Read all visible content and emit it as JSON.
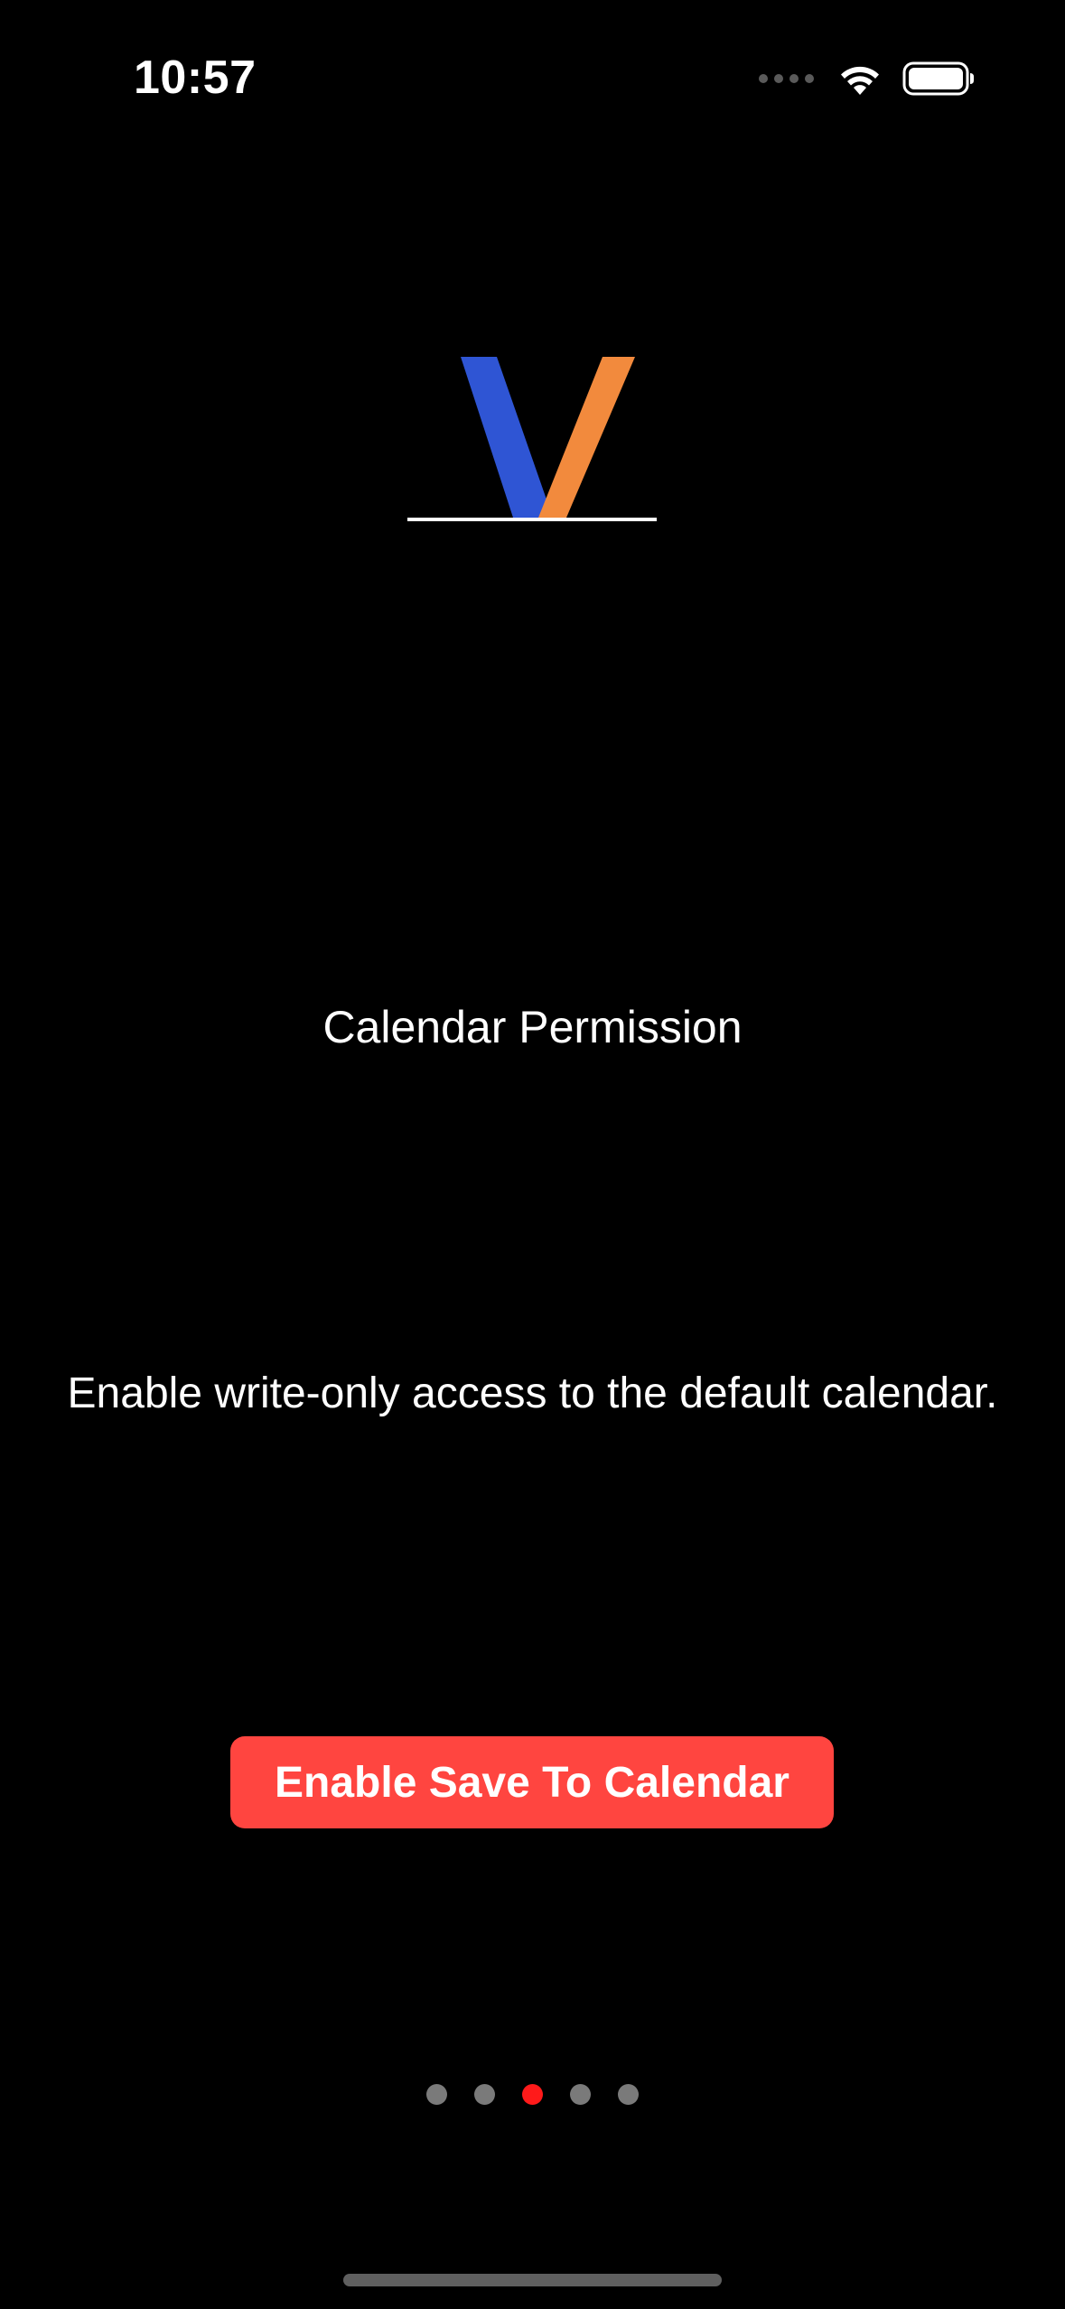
{
  "status_bar": {
    "time": "10:57",
    "icons": [
      "cellular-signal-icon",
      "wifi-icon",
      "battery-icon"
    ]
  },
  "logo": {
    "name": "v-logo",
    "colors": {
      "left_stroke": "#2f55d4",
      "right_stroke": "#f28a3d",
      "underline": "#ffffff"
    }
  },
  "main": {
    "title": "Calendar Permission",
    "description": "Enable write-only access to the default calendar.",
    "button_label": "Enable Save To Calendar"
  },
  "pager": {
    "total_pages": 5,
    "current_page": 3
  },
  "colors": {
    "background": "#000000",
    "button": "#ff4540",
    "active_dot": "#ff1a1a",
    "inactive_dot": "#7a7a7a"
  }
}
